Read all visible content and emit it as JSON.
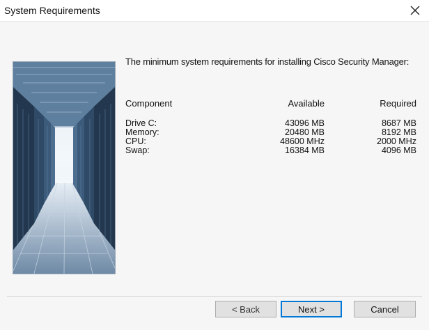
{
  "window": {
    "title": "System Requirements"
  },
  "intro_text": "The minimum system requirements for installing Cisco Security Manager:",
  "table": {
    "headers": {
      "component": "Component",
      "available": "Available",
      "required": "Required"
    },
    "rows": [
      {
        "component": "Drive C:",
        "available": "43096 MB",
        "required": "8687 MB"
      },
      {
        "component": "Memory:",
        "available": "20480 MB",
        "required": "8192 MB"
      },
      {
        "component": "CPU:",
        "available": "48600 MHz",
        "required": "2000 MHz"
      },
      {
        "component": "Swap:",
        "available": "16384 MB",
        "required": "4096 MB"
      }
    ]
  },
  "buttons": {
    "back": "< Back",
    "next": "Next >",
    "cancel": "Cancel"
  },
  "icons": {
    "close": "close-icon"
  },
  "colors": {
    "accent": "#0078d7",
    "button_face": "#e1e1e1",
    "panel": "#f6f6f6"
  }
}
